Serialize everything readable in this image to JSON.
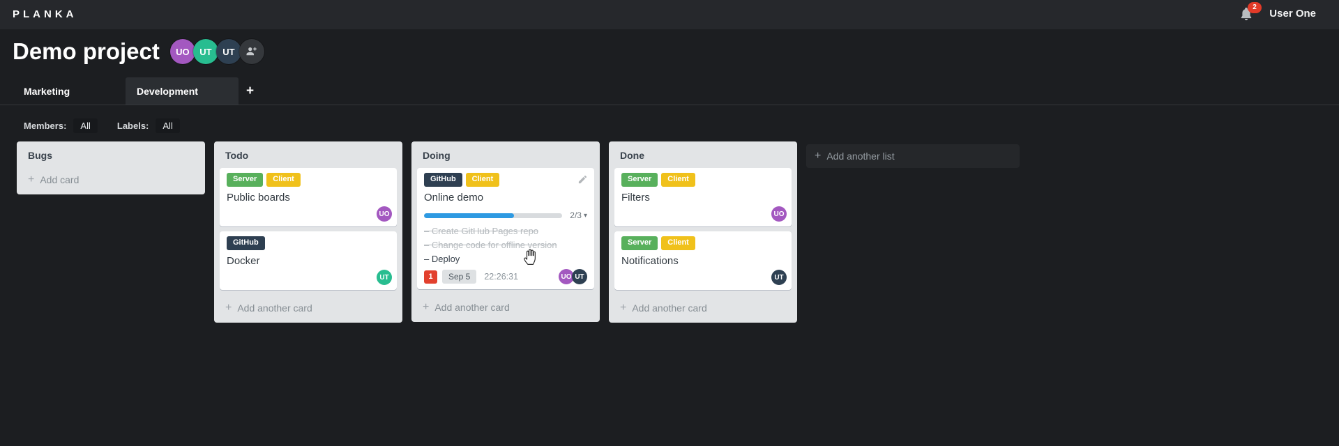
{
  "topbar": {
    "logo": "PLANKA",
    "user_name": "User One",
    "notification_count": "2"
  },
  "header": {
    "title": "Demo project",
    "avatars": [
      {
        "initials": "UO",
        "color": "#a358c0"
      },
      {
        "initials": "UT",
        "color": "#28bd90"
      },
      {
        "initials": "UT",
        "color": "#2e4052"
      }
    ]
  },
  "tabs": {
    "items": [
      {
        "label": "Marketing",
        "active": false
      },
      {
        "label": "Development",
        "active": true
      }
    ],
    "add_label": "+"
  },
  "filters": {
    "members_label": "Members:",
    "members_value": "All",
    "labels_label": "Labels:",
    "labels_value": "All"
  },
  "board": {
    "add_list_label": "Add another list",
    "lists": [
      {
        "name": "Bugs",
        "add_label": "Add card",
        "cards": []
      },
      {
        "name": "Todo",
        "add_label": "Add another card",
        "cards": [
          {
            "labels": [
              {
                "text": "Server",
                "color": "#58b05c"
              },
              {
                "text": "Client",
                "color": "#f0c11b"
              }
            ],
            "title": "Public boards",
            "avatars": [
              {
                "initials": "UO",
                "color": "#a358c0"
              }
            ]
          },
          {
            "labels": [
              {
                "text": "GitHub",
                "color": "#2e3f51"
              }
            ],
            "title": "Docker",
            "avatars": [
              {
                "initials": "UT",
                "color": "#28bd90"
              }
            ]
          }
        ]
      },
      {
        "name": "Doing",
        "add_label": "Add another card",
        "cards": [
          {
            "labels": [
              {
                "text": "GitHub",
                "color": "#2e3f51"
              },
              {
                "text": "Client",
                "color": "#f0c11b"
              }
            ],
            "title": "Online demo",
            "has_edit_icon": true,
            "progress": {
              "percent": 65,
              "label": "2/3",
              "color": "#2e9ae2"
            },
            "tasks": [
              {
                "text": "Create GitHub Pages repo",
                "done": true
              },
              {
                "text": "Change code for offline version",
                "done": true
              },
              {
                "text": "Deploy",
                "done": false
              }
            ],
            "badges": {
              "notification_count": "1",
              "notification_color": "#e2402e",
              "due_date": "Sep 5",
              "timer": "22:26:31"
            },
            "avatars": [
              {
                "initials": "UO",
                "color": "#a358c0"
              },
              {
                "initials": "UT",
                "color": "#2e4052"
              }
            ]
          }
        ]
      },
      {
        "name": "Done",
        "add_label": "Add another card",
        "cards": [
          {
            "labels": [
              {
                "text": "Server",
                "color": "#58b05c"
              },
              {
                "text": "Client",
                "color": "#f0c11b"
              }
            ],
            "title": "Filters",
            "avatars": [
              {
                "initials": "UO",
                "color": "#a358c0"
              }
            ]
          },
          {
            "labels": [
              {
                "text": "Server",
                "color": "#58b05c"
              },
              {
                "text": "Client",
                "color": "#f0c11b"
              }
            ],
            "title": "Notifications",
            "avatars": [
              {
                "initials": "UT",
                "color": "#2e4052"
              }
            ]
          }
        ]
      }
    ]
  }
}
